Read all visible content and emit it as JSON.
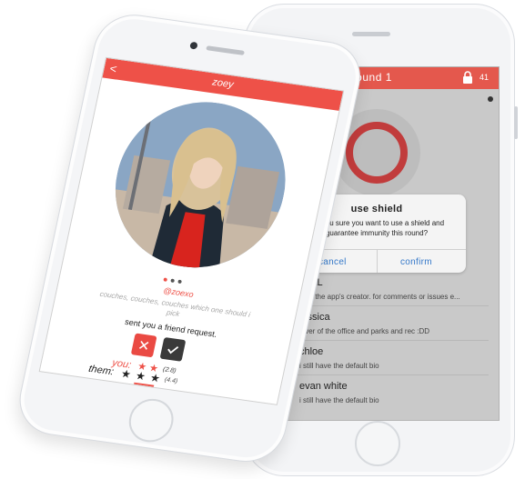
{
  "back_screen": {
    "header_title": "Round 1",
    "lock_count": "41",
    "dialog": {
      "title": "use shield",
      "message": "are you sure you want to use a shield and guarantee immunity this round?",
      "cancel": "cancel",
      "confirm": "confirm"
    },
    "players": [
      {
        "name": "WILL",
        "bio": "i am the app's creator. for comments or issues e..."
      },
      {
        "name": "jessica",
        "bio": "lover of the office and parks and rec :DD"
      },
      {
        "name": "chloe",
        "bio": "i still have the default bio"
      },
      {
        "name": "evan white",
        "bio": "i still have the default bio"
      }
    ]
  },
  "front_screen": {
    "header_title": "zoey",
    "back_icon": "<",
    "handle": "@zoexo",
    "bio": "couches, couches, couches which one should i pick",
    "request_text": "sent you a friend request.",
    "you_label": "you:",
    "you_stars": "★ ★",
    "you_count": "(2.8)",
    "them_label": "them:",
    "them_stars": "★ ★ ★",
    "them_count": "(4.4)",
    "carousel_pages": 3,
    "carousel_active": 1
  },
  "colors": {
    "accent": "#ee5148",
    "dialog_button": "#3478c9",
    "dark_button": "#3a3a3a"
  },
  "icons": [
    "back-chevron-icon",
    "lock-icon",
    "close-icon",
    "check-icon",
    "default-avatar-icon",
    "star-icon"
  ]
}
